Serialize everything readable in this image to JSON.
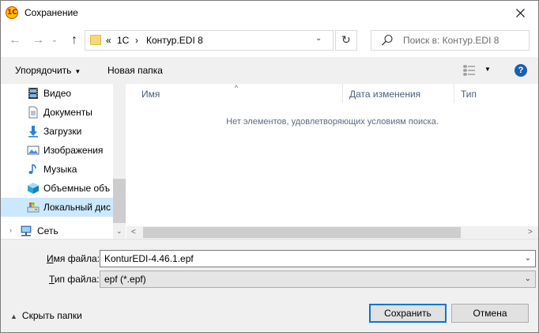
{
  "window": {
    "title": "Сохранение",
    "app_icon": "1c-icon",
    "app_icon_text": "1С"
  },
  "nav": {
    "address": {
      "overflow": "«",
      "segments": [
        "1С",
        "Контур.EDI 8"
      ],
      "separator": "›"
    },
    "search_placeholder": "Поиск в: Контур.EDI 8"
  },
  "toolbar": {
    "organize_label": "Упорядочить",
    "new_folder_label": "Новая папка",
    "help_label": "?"
  },
  "sidebar": {
    "items": [
      {
        "label": "Видео",
        "icon": "video-icon"
      },
      {
        "label": "Документы",
        "icon": "documents-icon"
      },
      {
        "label": "Загрузки",
        "icon": "downloads-icon"
      },
      {
        "label": "Изображения",
        "icon": "pictures-icon"
      },
      {
        "label": "Музыка",
        "icon": "music-icon"
      },
      {
        "label": "Объемные объ",
        "icon": "3d-objects-icon"
      },
      {
        "label": "Локальный дис",
        "icon": "local-disk-icon"
      },
      {
        "label": "Сеть",
        "icon": "network-icon"
      }
    ]
  },
  "filelist": {
    "columns": [
      "Имя",
      "Дата изменения",
      "Тип"
    ],
    "empty_message": "Нет элементов, удовлетворяющих условиям поиска."
  },
  "form": {
    "filename_label": "Имя файла:",
    "filename_label_underline": "И",
    "filename_label_rest": "мя файла:",
    "filename_value": "KonturEDI-4.46.1.epf",
    "filetype_label_underline": "Т",
    "filetype_label_rest": "ип файла:",
    "filetype_value": "epf (*.epf)"
  },
  "footer": {
    "hide_folders_label": "Скрыть папки",
    "save_label": "Сохранить",
    "cancel_label": "Отмена"
  },
  "colors": {
    "accent": "#0078d7",
    "selected_bg": "#cce8ff",
    "header_text": "#4c607a"
  }
}
